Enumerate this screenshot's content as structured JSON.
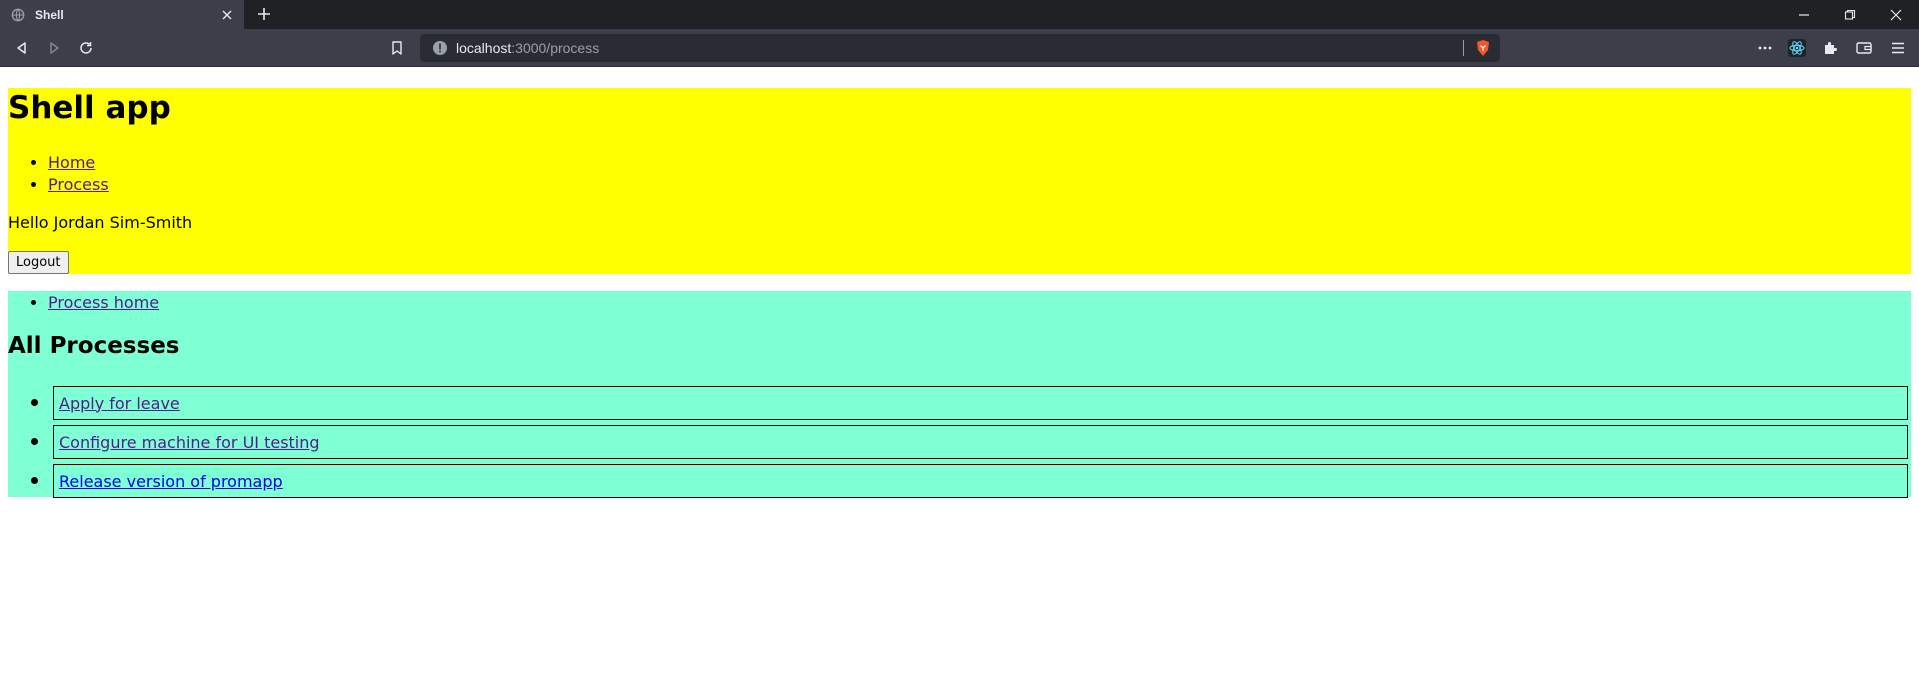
{
  "browser": {
    "tab_title": "Shell",
    "url_host": "localhost",
    "url_rest": ":3000/process"
  },
  "app": {
    "title": "Shell app",
    "nav": [
      {
        "label": "Home"
      },
      {
        "label": "Process"
      }
    ],
    "greeting": "Hello Jordan Sim-Smith",
    "logout_label": "Logout"
  },
  "process": {
    "nav": [
      {
        "label": "Process home"
      }
    ],
    "heading": "All Processes",
    "items": [
      {
        "label": "Apply for leave",
        "visited": true
      },
      {
        "label": "Configure machine for UI testing",
        "visited": true
      },
      {
        "label": "Release version of promapp",
        "visited": false
      }
    ]
  },
  "colors": {
    "header_bg": "#ffff00",
    "process_bg": "#7fffd4",
    "visited_link": "#551a8b",
    "unvisited_link": "#0000ee"
  }
}
